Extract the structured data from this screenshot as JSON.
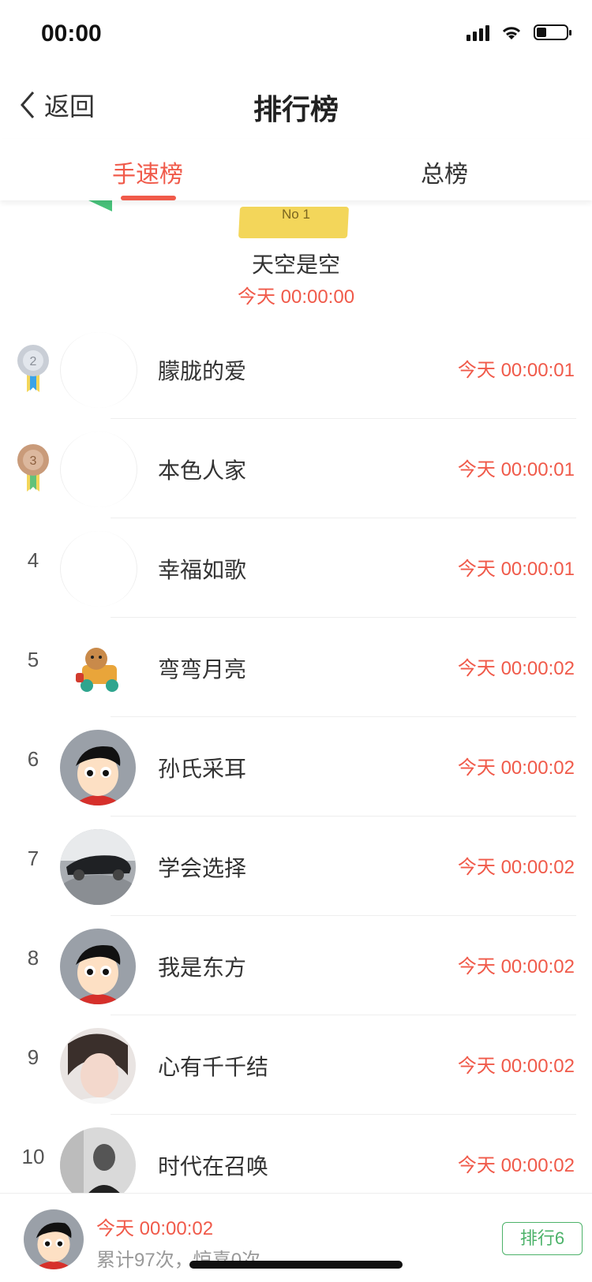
{
  "status_bar": {
    "time": "00:00"
  },
  "nav": {
    "back_label": "返回",
    "title": "排行榜"
  },
  "tabs": [
    {
      "label": "手速榜"
    },
    {
      "label": "总榜"
    }
  ],
  "top1": {
    "badge_text": "No 1",
    "name": "天空是空",
    "time": "今天 00:00:00"
  },
  "rankings": [
    {
      "rank": "2",
      "name": "朦胧的爱",
      "time": "今天 00:00:01",
      "medal": "silver"
    },
    {
      "rank": "3",
      "name": "本色人家",
      "time": "今天 00:00:01",
      "medal": "bronze"
    },
    {
      "rank": "4",
      "name": "幸福如歌",
      "time": "今天 00:00:01"
    },
    {
      "rank": "5",
      "name": "弯弯月亮",
      "time": "今天 00:00:02"
    },
    {
      "rank": "6",
      "name": "孙氏采耳",
      "time": "今天 00:00:02"
    },
    {
      "rank": "7",
      "name": "学会选择",
      "time": "今天 00:00:02"
    },
    {
      "rank": "8",
      "name": "我是东方",
      "time": "今天 00:00:02"
    },
    {
      "rank": "9",
      "name": "心有千千结",
      "time": "今天 00:00:02"
    },
    {
      "rank": "10",
      "name": "时代在召唤",
      "time": "今天 00:00:02"
    }
  ],
  "bottom": {
    "time": "今天 00:00:02",
    "summary": "累计97次，惊喜0次",
    "rank_button": "排行6"
  },
  "colors": {
    "accent": "#f05a4a",
    "green": "#4cb269",
    "ribbon": "#f3d65a"
  }
}
